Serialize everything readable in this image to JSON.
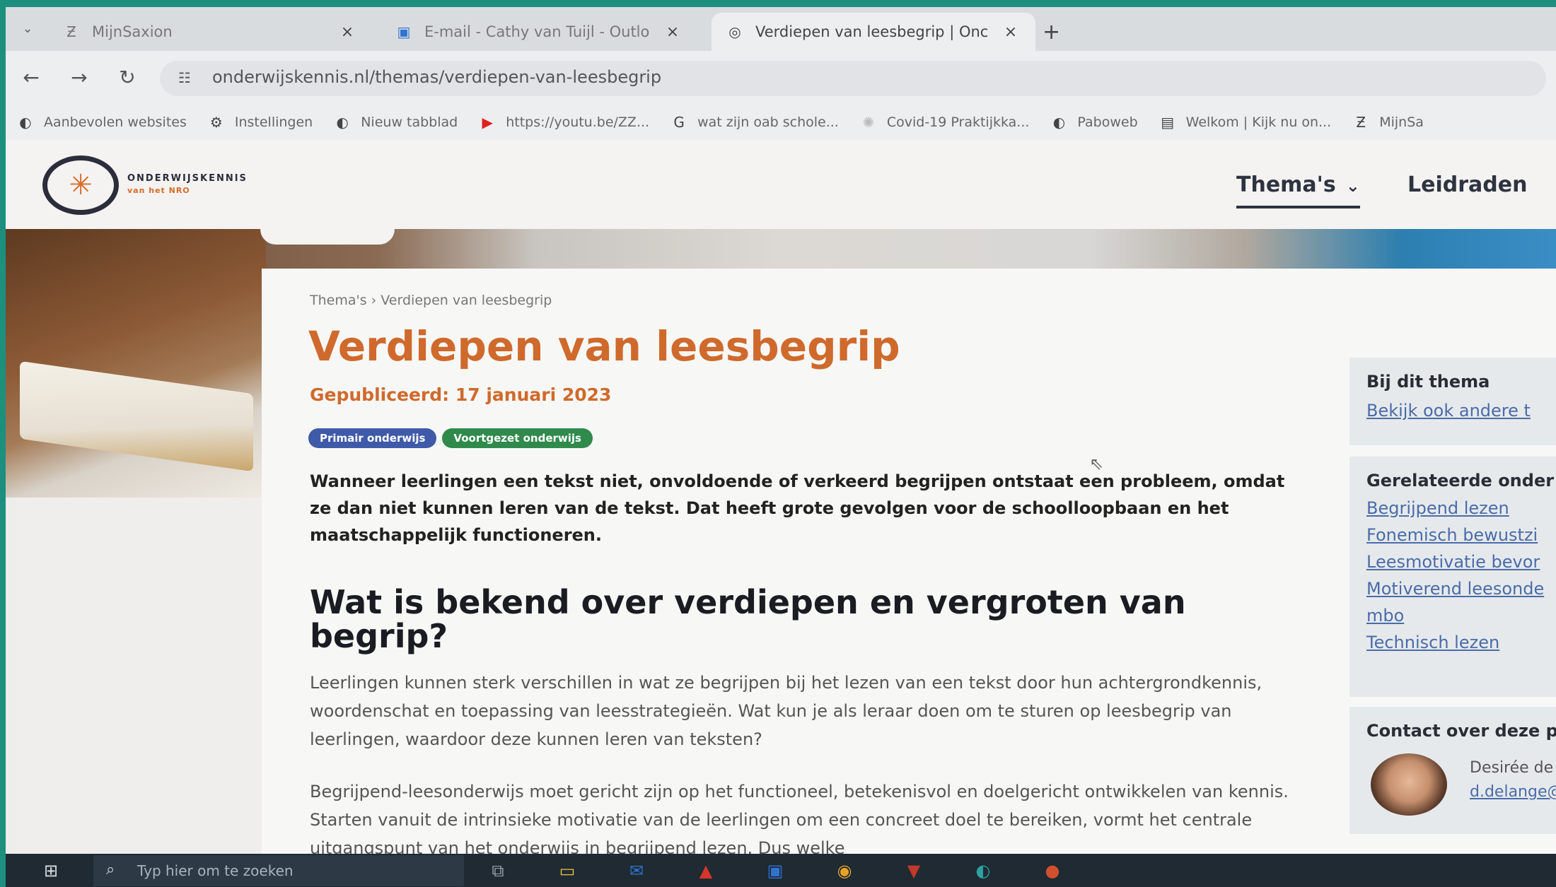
{
  "browser": {
    "tabs": [
      {
        "title": "MijnSaxion",
        "icon": "saxion-icon"
      },
      {
        "title": "E-mail - Cathy van Tuijl - Outlo",
        "icon": "outlook-icon"
      },
      {
        "title": "Verdiepen van leesbegrip | Onc",
        "icon": "globe-icon",
        "active": true
      }
    ],
    "new_tab": "+",
    "close_glyph": "×",
    "url": "onderwijskennis.nl/themas/verdiepen-van-leesbegrip",
    "bookmarks": [
      {
        "label": "Aanbevolen websites",
        "icon": "globe-icon"
      },
      {
        "label": "Instellingen",
        "icon": "gear-icon"
      },
      {
        "label": "Nieuw tabblad",
        "icon": "globe-icon"
      },
      {
        "label": "https://youtu.be/ZZ...",
        "icon": "youtube-icon"
      },
      {
        "label": "wat zijn oab schole...",
        "icon": "google-icon"
      },
      {
        "label": "Covid-19 Praktijkka...",
        "icon": "covid-icon"
      },
      {
        "label": "Paboweb",
        "icon": "globe-icon"
      },
      {
        "label": "Welkom | Kijk nu on...",
        "icon": "page-icon"
      },
      {
        "label": "MijnSa",
        "icon": "saxion-icon"
      }
    ]
  },
  "site": {
    "logo_name": "ONDERWIJSKENNIS",
    "logo_sub": "van het NRO",
    "nav": {
      "themas": "Thema's",
      "leidraden": "Leidraden"
    }
  },
  "article": {
    "breadcrumb": "Thema's  › Verdiepen van leesbegrip",
    "title": "Verdiepen van leesbegrip",
    "published": "Gepubliceerd: 17 januari 2023",
    "tags": [
      "Primair onderwijs",
      "Voortgezet onderwijs"
    ],
    "intro": "Wanneer leerlingen een tekst niet, onvoldoende of verkeerd begrijpen ontstaat een probleem, omdat ze dan niet kunnen leren van de tekst. Dat heeft grote gevolgen voor de schoolloopbaan en het maatschappelijk functioneren.",
    "h2": "Wat is bekend over verdiepen en vergroten van begrip?",
    "para1": "Leerlingen kunnen sterk verschillen in wat ze begrijpen bij het lezen van een tekst door hun achtergrondkennis, woordenschat en toepassing van leesstrategieën. Wat kun je als leraar doen om te sturen op leesbegrip van leerlingen, waardoor deze kunnen leren van teksten?",
    "para2": "Begrijpend-leesonderwijs moet gericht zijn op het functioneel, betekenisvol en doelgericht ontwikkelen van kennis. Starten vanuit de intrinsieke motivatie van de leerlingen om een concreet doel te bereiken, vormt het centrale uitgangspunt van het onderwijs in begrijpend lezen. Dus welke"
  },
  "sidebar": {
    "box1": {
      "title": "Bij dit thema",
      "link": "Bekijk ook andere t"
    },
    "box2": {
      "title": "Gerelateerde onder",
      "links": [
        "Begrijpend lezen",
        "Fonemisch bewustzi",
        "Leesmotivatie bevor",
        "Motiverend leesonde",
        "mbo",
        "Technisch lezen"
      ]
    },
    "box3": {
      "title": "Contact over deze pa",
      "name": "Desirée de L",
      "email": "d.delange@"
    }
  },
  "taskbar": {
    "search_placeholder": "Typ hier om te zoeken",
    "icons": [
      {
        "name": "task-view-icon",
        "color": "#9aa4ad"
      },
      {
        "name": "file-explorer-icon",
        "color": "#f2c23a"
      },
      {
        "name": "outlook-icon",
        "color": "#2f74d0"
      },
      {
        "name": "acrobat-icon",
        "color": "#d6352b"
      },
      {
        "name": "teams-icon",
        "color": "#2f74d0"
      },
      {
        "name": "chrome-icon",
        "color": "#e6a32a"
      },
      {
        "name": "app-icon",
        "color": "#c0392b"
      },
      {
        "name": "edge-icon",
        "color": "#2ca3a0"
      },
      {
        "name": "powerpoint-icon",
        "color": "#d1502d"
      }
    ]
  }
}
